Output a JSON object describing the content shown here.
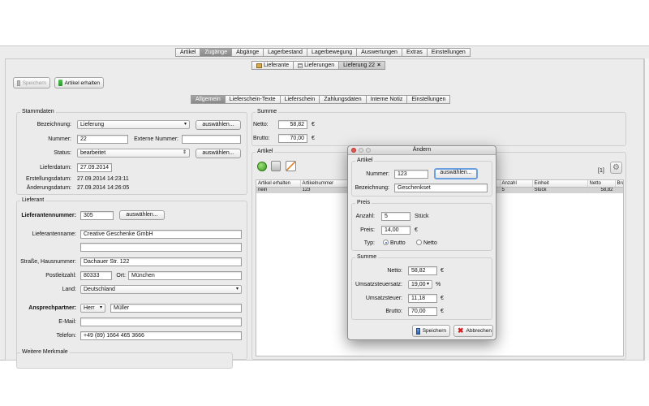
{
  "main_tabs": [
    {
      "label": "Artikel"
    },
    {
      "label": "Zugänge"
    },
    {
      "label": "Abgänge"
    },
    {
      "label": "Lagerbestand"
    },
    {
      "label": "Lagerbewegung"
    },
    {
      "label": "Auswertungen"
    },
    {
      "label": "Extras"
    },
    {
      "label": "Einstellungen"
    }
  ],
  "sub_tabs": [
    {
      "label": "Lieferante"
    },
    {
      "label": "Lieferungen"
    },
    {
      "label": "Lieferung 22",
      "close": "×"
    }
  ],
  "toolbar": {
    "save_label": "Speichern",
    "receive_label": "Artikel erhalten"
  },
  "detail_tabs": [
    {
      "label": "Allgemein"
    },
    {
      "label": "Lieferschein-Texte"
    },
    {
      "label": "Lieferschein"
    },
    {
      "label": "Zahlungsdaten"
    },
    {
      "label": "Interne Notiz"
    },
    {
      "label": "Einstellungen"
    }
  ],
  "stammdaten": {
    "title": "Stammdaten",
    "bezeichnung_label": "Bezeichnung:",
    "bezeichnung_value": "Lieferung",
    "nummer_label": "Nummer:",
    "nummer_value": "22",
    "externe_label": "Externe Nummer:",
    "externe_value": "",
    "status_label": "Status:",
    "status_value": "bearbeitet",
    "select_label": "auswählen...",
    "lieferdatum_label": "Lieferdatum:",
    "lieferdatum_value": "27.09.2014",
    "erstellung_label": "Erstellungsdatum:",
    "erstellung_value": "27.09.2014 14:23:11",
    "aenderung_label": "Änderungsdatum:",
    "aenderung_value": "27.09.2014 14:26:05"
  },
  "lieferant": {
    "title": "Lieferant",
    "nummer_label": "Lieferantennummer:",
    "nummer_value": "305",
    "select_label": "auswählen...",
    "name_label": "Lieferantenname:",
    "name_value": "Creative Geschenke GmbH",
    "name2_value": "",
    "strasse_label": "Straße, Hausnummer:",
    "strasse_value": "Dachauer Str. 122",
    "plz_label": "Postleitzahl:",
    "plz_value": "80333",
    "ort_label": "Ort:",
    "ort_value": "München",
    "land_label": "Land:",
    "land_value": "Deutschland",
    "ansprech_label": "Ansprechpartner:",
    "anrede_value": "Herr",
    "ansprech_value": "Müller",
    "email_label": "E-Mail:",
    "email_value": "",
    "telefon_label": "Telefon:",
    "telefon_value": "+49 (89) 1664 465 3666"
  },
  "weitere": {
    "title": "Weitere Merkmale"
  },
  "summe": {
    "title": "Summe",
    "netto_label": "Netto:",
    "netto_value": "58,82",
    "brutto_label": "Brutto:",
    "brutto_value": "70,00",
    "currency": "€"
  },
  "artikel": {
    "title": "Artikel",
    "count": "[1]",
    "columns": [
      "Artikel erhalten",
      "Artikelnummer",
      "Anzahl",
      "Einheit",
      "Netto",
      "Bru"
    ],
    "rows": [
      {
        "erhalten": "nein",
        "nummer": "123",
        "anzahl": "5",
        "einheit": "Stück",
        "netto": "58,82",
        "brutto": ""
      }
    ]
  },
  "dialog": {
    "title": "Ändern",
    "artikel_title": "Artikel",
    "nummer_label": "Nummer:",
    "nummer_value": "123",
    "select_label": "auswählen...",
    "bezeichnung_label": "Bezeichnung:",
    "bezeichnung_value": "Geschenkset",
    "preis_title": "Preis",
    "anzahl_label": "Anzahl:",
    "anzahl_value": "5",
    "anzahl_unit": "Stück",
    "preis_label": "Preis:",
    "preis_value": "14,00",
    "currency": "€",
    "typ_label": "Typ:",
    "typ_brutto": "Brutto",
    "typ_netto": "Netto",
    "summe_title": "Summe",
    "netto_label": "Netto:",
    "netto_value": "58,82",
    "ust_satz_label": "Umsatzsteuersatz:",
    "ust_satz_value": "19,00",
    "percent": "%",
    "ust_label": "Umsatzsteuer:",
    "ust_value": "11,18",
    "brutto_label": "Brutto:",
    "brutto_value": "70,00",
    "save_label": "Speichern",
    "cancel_label": "Abbrechen"
  }
}
